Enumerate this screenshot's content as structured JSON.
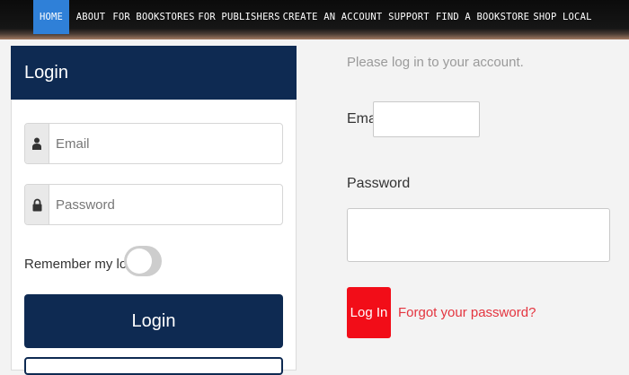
{
  "nav": {
    "items": [
      {
        "label": "HOME",
        "active": true
      },
      {
        "label": "ABOUT"
      },
      {
        "label": "FOR BOOKSTORES"
      },
      {
        "label": "FOR PUBLISHERS"
      },
      {
        "label": "CREATE AN ACCOUNT"
      },
      {
        "label": "SUPPORT"
      },
      {
        "label": "FIND A BOOKSTORE"
      },
      {
        "label": "SHOP LOCAL"
      }
    ]
  },
  "login_panel": {
    "title": "Login",
    "email_placeholder": "Email",
    "password_placeholder": "Password",
    "remember_label": "Remember my login",
    "remember_on": false,
    "login_button": "Login",
    "icons": {
      "email": "user-icon",
      "password": "lock-icon"
    }
  },
  "account_form": {
    "prompt": "Please log in to your account.",
    "email_label": "Email",
    "password_label": "Password",
    "login_button": "Log In",
    "forgot_link": "Forgot your password?"
  },
  "colors": {
    "nav_active": "#2f80d8",
    "panel_navy": "#0e2a52",
    "login_red": "#f20d18",
    "link_red": "#e4343f"
  }
}
